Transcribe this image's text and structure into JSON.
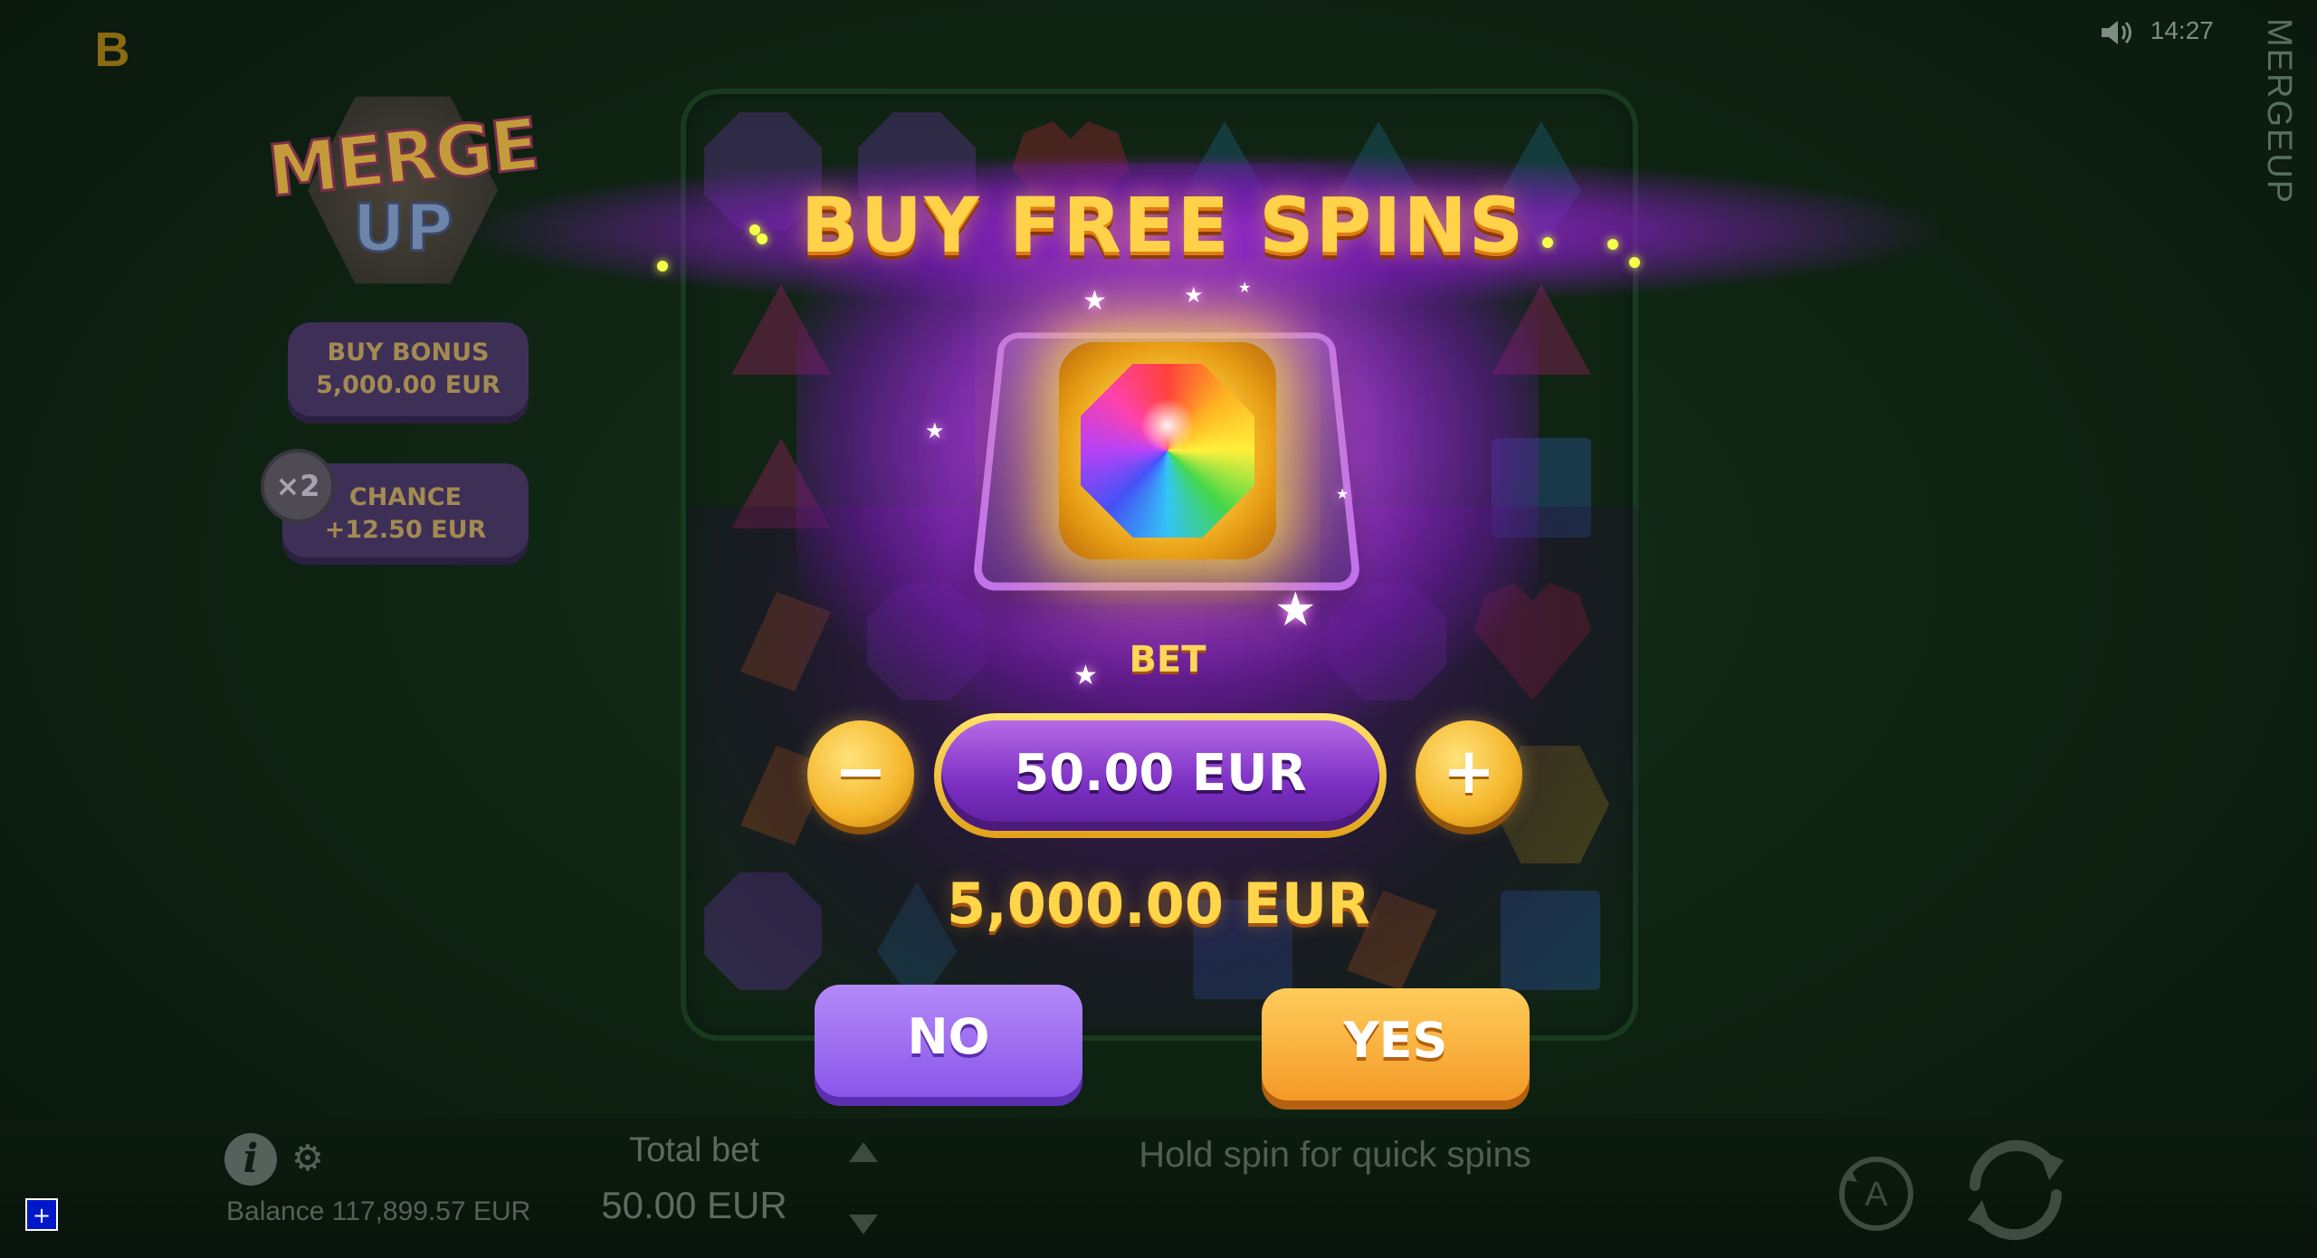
{
  "top_bar": {
    "brand_letter": "B",
    "time": "14:27",
    "sound_icon": "speaker-icon",
    "side_title": "MERGEUP"
  },
  "game_logo": {
    "line1": "MERGE",
    "line2": "UP"
  },
  "side_panel": {
    "buy_bonus": {
      "title": "BUY BONUS",
      "price": "5,000.00 EUR"
    },
    "chance": {
      "multiplier": "×2",
      "title": "CHANCE",
      "price": "+12.50 EUR"
    }
  },
  "modal": {
    "title": "BUY FREE SPINS",
    "bet_label": "BET",
    "bet_value": "50.00 EUR",
    "minus_label": "−",
    "plus_label": "+",
    "total_price": "5,000.00 EUR",
    "no_label": "NO",
    "yes_label": "YES"
  },
  "bottom_bar": {
    "info_icon": "info-icon",
    "settings_icon": "gear-icon",
    "balance": "Balance 117,899.57 EUR",
    "total_bet_label": "Total bet",
    "total_bet_value": "50.00 EUR",
    "hint": "Hold spin for quick spins",
    "autoplay_letter": "A",
    "debug_label": "+"
  },
  "colors": {
    "background": "#0f2413",
    "modal_purple": "#9b3bd6",
    "title_gold": "#ffd24a",
    "no_button": "#9b6ef2",
    "yes_button": "#f7ad3a"
  }
}
